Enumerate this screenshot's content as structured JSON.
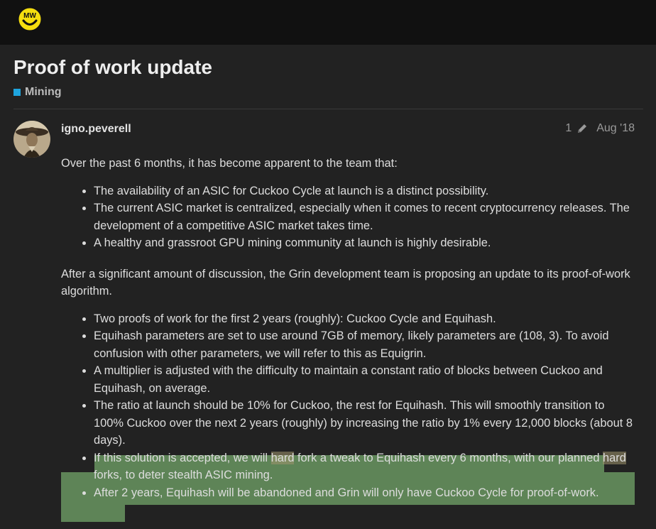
{
  "header": {
    "logo_text": "MW",
    "logo_icon": "smiley-face-icon",
    "logo_color": "#f5de0f"
  },
  "topic": {
    "title": "Proof of work update",
    "category": {
      "label": "Mining",
      "color": "#1ea4de"
    }
  },
  "post": {
    "author": "igno.peverell",
    "edit_count": "1",
    "date": "Aug '18",
    "intro": "Over the past 6 months, it has become apparent to the team that:",
    "points1": [
      "The availability of an ASIC for Cuckoo Cycle at launch is a distinct possibility.",
      "The current ASIC market is centralized, especially when it comes to recent cryptocurrency releases. The development of a competitive ASIC market takes time.",
      "A healthy and grassroot GPU mining community at launch is highly desirable."
    ],
    "proposal": "After a significant amount of discussion, the Grin development team is proposing an update to its proof-of-work algorithm.",
    "points2": [
      "Two proofs of work for the first 2 years (roughly): Cuckoo Cycle and Equihash.",
      "Equihash parameters are set to use around 7GB of memory, likely parameters are (108, 3). To avoid confusion with other parameters, we will refer to this as Equigrin.",
      "A multiplier is adjusted with the difficulty to maintain a constant ratio of blocks between Cuckoo and Equihash, on average.",
      "The ratio at launch should be 10% for Cuckoo, the rest for Equihash. This will smoothly transition to 100% Cuckoo over the next 2 years (roughly) by increasing the ratio by 1% every 12,000 blocks (about 8 days)."
    ],
    "point_hardfork": {
      "part1": "If this solution is accepted, we will ",
      "word1": "hard",
      "part2": " fork a tweak to Equihash every 6 months, with our planned ",
      "word2": "hard",
      "part3": " forks, to deter stealth ASIC mining."
    },
    "point_final": "After 2 years, Equihash will be abandoned and Grin will only have Cuckoo Cycle for proof-of-work."
  }
}
